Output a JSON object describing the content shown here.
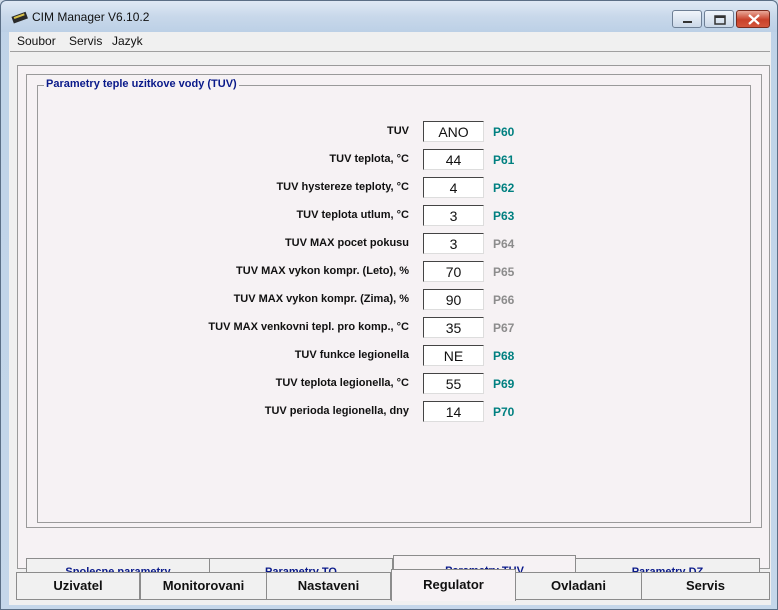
{
  "window": {
    "title": "CIM Manager   V6.10.2"
  },
  "menu": [
    "Soubor",
    "Servis",
    "Jazyk"
  ],
  "group": {
    "title": "Parametry teple uzitkove vody (TUV)"
  },
  "colors": {
    "active_code": "#008080",
    "inactive_code": "#8c8c8c",
    "tab_text": "#0a1a8a"
  },
  "params": [
    {
      "label": "TUV",
      "value": "ANO",
      "code": "P60",
      "active": true
    },
    {
      "label": "TUV teplota, °C",
      "value": "44",
      "code": "P61",
      "active": true
    },
    {
      "label": "TUV hystereze teploty, °C",
      "value": "4",
      "code": "P62",
      "active": true
    },
    {
      "label": "TUV teplota utlum, °C",
      "value": "3",
      "code": "P63",
      "active": true
    },
    {
      "label": "TUV MAX pocet pokusu",
      "value": "3",
      "code": "P64",
      "active": false
    },
    {
      "label": "TUV MAX vykon kompr. (Leto), %",
      "value": "70",
      "code": "P65",
      "active": false
    },
    {
      "label": "TUV MAX vykon kompr. (Zima), %",
      "value": "90",
      "code": "P66",
      "active": false
    },
    {
      "label": "TUV MAX venkovni tepl. pro komp., °C",
      "value": "35",
      "code": "P67",
      "active": false
    },
    {
      "label": "TUV funkce legionella",
      "value": "NE",
      "code": "P68",
      "active": true
    },
    {
      "label": "TUV teplota legionella, °C",
      "value": "55",
      "code": "P69",
      "active": true
    },
    {
      "label": "TUV perioda legionella, dny",
      "value": "14",
      "code": "P70",
      "active": true
    }
  ],
  "subtabs": [
    "Spolecne parametry",
    "Parametry TO",
    "Parametry TUV",
    "Parametry DZ"
  ],
  "subtab_active": "Parametry TUV",
  "tabs": [
    "Uzivatel",
    "Monitorovani",
    "Nastaveni",
    "Regulator",
    "Ovladani",
    "Servis"
  ],
  "tab_active": "Regulator"
}
